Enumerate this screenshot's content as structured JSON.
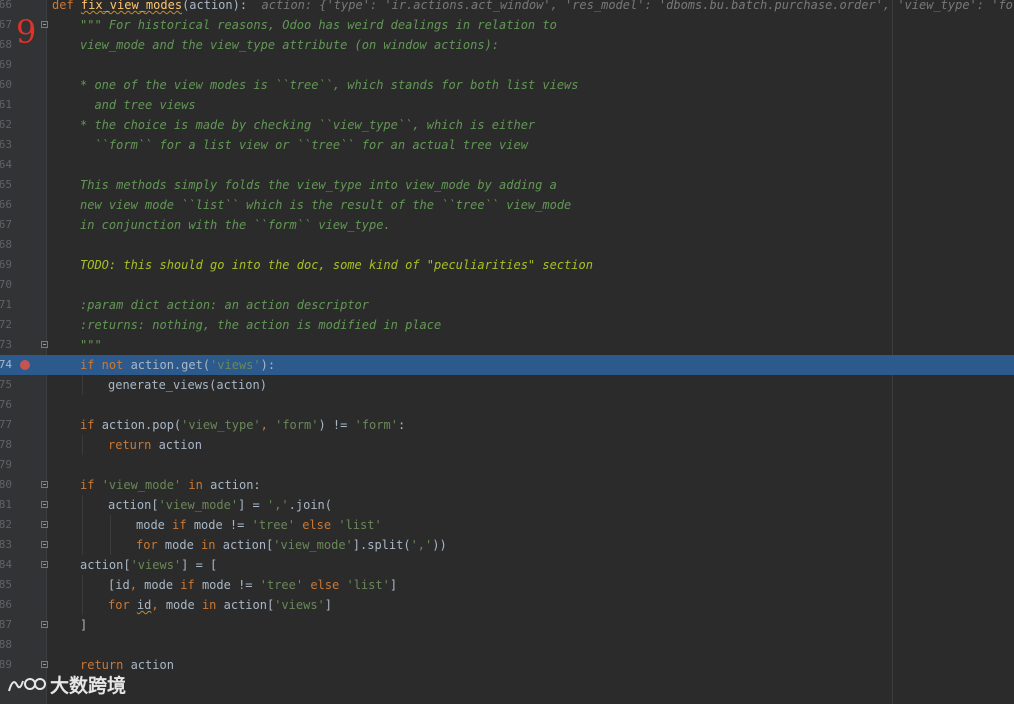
{
  "annotation_badge": "9",
  "watermark_text": "大数跨境",
  "colors": {
    "keyword": "#cc7832",
    "string": "#6a8759",
    "docstring": "#629755",
    "todo": "#a8c023",
    "function": "#ffc66d",
    "selection": "#2d5a8c",
    "breakpoint": "#c75450"
  },
  "lines": [
    {
      "ln": "66",
      "fold": false,
      "bp": false,
      "hl": false,
      "indent": 0,
      "tokens": [
        {
          "t": "kw",
          "v": "def "
        },
        {
          "t": "fn",
          "v": "fix_view_modes",
          "warn": true
        },
        {
          "t": "",
          "v": "(action):  "
        },
        {
          "t": "hint",
          "v": "action: {'type': 'ir.actions.act_window', 'res_model': 'dboms.bu.batch.purchase.order', 'view_type': 'form',"
        }
      ]
    },
    {
      "ln": "67",
      "fold": true,
      "bp": false,
      "hl": false,
      "indent": 1,
      "tokens": [
        {
          "t": "doc",
          "v": "\"\"\" For historical reasons, Odoo has weird dealings in relation to"
        }
      ]
    },
    {
      "ln": "68",
      "fold": false,
      "bp": false,
      "hl": false,
      "indent": 1,
      "tokens": [
        {
          "t": "doc",
          "v": "view_mode and the view_type attribute (on window actions):"
        }
      ]
    },
    {
      "ln": "69",
      "fold": false,
      "bp": false,
      "hl": false,
      "indent": 1,
      "tokens": []
    },
    {
      "ln": "60",
      "fold": false,
      "bp": false,
      "hl": false,
      "indent": 1,
      "tokens": [
        {
          "t": "doc",
          "v": "* one of the view modes is ``tree``, which stands for both list views"
        }
      ]
    },
    {
      "ln": "61",
      "fold": false,
      "bp": false,
      "hl": false,
      "indent": 1,
      "tokens": [
        {
          "t": "doc",
          "v": "  and tree views"
        }
      ]
    },
    {
      "ln": "62",
      "fold": false,
      "bp": false,
      "hl": false,
      "indent": 1,
      "tokens": [
        {
          "t": "doc",
          "v": "* the choice is made by checking ``view_type``, which is either"
        }
      ]
    },
    {
      "ln": "63",
      "fold": false,
      "bp": false,
      "hl": false,
      "indent": 1,
      "tokens": [
        {
          "t": "doc",
          "v": "  ``form`` for a list view or ``tree`` for an actual tree view"
        }
      ]
    },
    {
      "ln": "64",
      "fold": false,
      "bp": false,
      "hl": false,
      "indent": 1,
      "tokens": []
    },
    {
      "ln": "65",
      "fold": false,
      "bp": false,
      "hl": false,
      "indent": 1,
      "tokens": [
        {
          "t": "doc",
          "v": "This methods simply folds the view_type into view_mode by adding a"
        }
      ]
    },
    {
      "ln": "66",
      "fold": false,
      "bp": false,
      "hl": false,
      "indent": 1,
      "tokens": [
        {
          "t": "doc",
          "v": "new view mode ``list`` which is the result of the ``tree`` view_mode"
        }
      ]
    },
    {
      "ln": "67",
      "fold": false,
      "bp": false,
      "hl": false,
      "indent": 1,
      "tokens": [
        {
          "t": "doc",
          "v": "in conjunction with the ``form`` view_type."
        }
      ]
    },
    {
      "ln": "68",
      "fold": false,
      "bp": false,
      "hl": false,
      "indent": 1,
      "tokens": []
    },
    {
      "ln": "69",
      "fold": false,
      "bp": false,
      "hl": false,
      "indent": 1,
      "tokens": [
        {
          "t": "todo",
          "v": "TODO: this should go into the doc, some kind of \"peculiarities\" section"
        }
      ]
    },
    {
      "ln": "70",
      "fold": false,
      "bp": false,
      "hl": false,
      "indent": 1,
      "tokens": []
    },
    {
      "ln": "71",
      "fold": false,
      "bp": false,
      "hl": false,
      "indent": 1,
      "tokens": [
        {
          "t": "doc",
          "v": ":param dict action: an action descriptor"
        }
      ]
    },
    {
      "ln": "72",
      "fold": false,
      "bp": false,
      "hl": false,
      "indent": 1,
      "tokens": [
        {
          "t": "doc",
          "v": ":returns: nothing, the action is modified in place"
        }
      ]
    },
    {
      "ln": "73",
      "fold": true,
      "bp": false,
      "hl": false,
      "indent": 1,
      "tokens": [
        {
          "t": "doc",
          "v": "\"\"\""
        }
      ]
    },
    {
      "ln": "74",
      "fold": false,
      "bp": true,
      "hl": true,
      "indent": 1,
      "tokens": [
        {
          "t": "kw",
          "v": "if not "
        },
        {
          "t": "",
          "v": "action.get("
        },
        {
          "t": "str",
          "v": "'views'"
        },
        {
          "t": "",
          "v": "):"
        }
      ]
    },
    {
      "ln": "75",
      "fold": false,
      "bp": false,
      "hl": false,
      "indent": 2,
      "tokens": [
        {
          "t": "",
          "v": "generate_views(action)"
        }
      ]
    },
    {
      "ln": "76",
      "fold": false,
      "bp": false,
      "hl": false,
      "indent": 1,
      "tokens": []
    },
    {
      "ln": "77",
      "fold": false,
      "bp": false,
      "hl": false,
      "indent": 1,
      "tokens": [
        {
          "t": "kw",
          "v": "if "
        },
        {
          "t": "",
          "v": "action.pop("
        },
        {
          "t": "str",
          "v": "'view_type'"
        },
        {
          "t": "kw",
          "v": ", "
        },
        {
          "t": "str",
          "v": "'form'"
        },
        {
          "t": "",
          "v": ") != "
        },
        {
          "t": "str",
          "v": "'form'"
        },
        {
          "t": "",
          "v": ":"
        }
      ]
    },
    {
      "ln": "78",
      "fold": false,
      "bp": false,
      "hl": false,
      "indent": 2,
      "tokens": [
        {
          "t": "kw",
          "v": "return "
        },
        {
          "t": "",
          "v": "action"
        }
      ]
    },
    {
      "ln": "79",
      "fold": false,
      "bp": false,
      "hl": false,
      "indent": 1,
      "tokens": []
    },
    {
      "ln": "80",
      "fold": true,
      "bp": false,
      "hl": false,
      "indent": 1,
      "tokens": [
        {
          "t": "kw",
          "v": "if "
        },
        {
          "t": "str",
          "v": "'view_mode'"
        },
        {
          "t": "kw",
          "v": " in "
        },
        {
          "t": "",
          "v": "action:"
        }
      ]
    },
    {
      "ln": "81",
      "fold": true,
      "bp": false,
      "hl": false,
      "indent": 2,
      "tokens": [
        {
          "t": "",
          "v": "action["
        },
        {
          "t": "str",
          "v": "'view_mode'"
        },
        {
          "t": "",
          "v": "] = "
        },
        {
          "t": "str",
          "v": "','"
        },
        {
          "t": "",
          "v": ".join("
        }
      ]
    },
    {
      "ln": "82",
      "fold": true,
      "bp": false,
      "hl": false,
      "indent": 3,
      "tokens": [
        {
          "t": "",
          "v": "mode "
        },
        {
          "t": "kw",
          "v": "if "
        },
        {
          "t": "",
          "v": "mode != "
        },
        {
          "t": "str",
          "v": "'tree'"
        },
        {
          "t": "kw",
          "v": " else "
        },
        {
          "t": "str",
          "v": "'list'"
        }
      ]
    },
    {
      "ln": "83",
      "fold": true,
      "bp": false,
      "hl": false,
      "indent": 3,
      "tokens": [
        {
          "t": "kw",
          "v": "for "
        },
        {
          "t": "",
          "v": "mode "
        },
        {
          "t": "kw",
          "v": "in "
        },
        {
          "t": "",
          "v": "action["
        },
        {
          "t": "str",
          "v": "'view_mode'"
        },
        {
          "t": "",
          "v": "].split("
        },
        {
          "t": "str",
          "v": "','"
        },
        {
          "t": "",
          "v": "))"
        }
      ]
    },
    {
      "ln": "84",
      "fold": true,
      "bp": false,
      "hl": false,
      "indent": 1,
      "tokens": [
        {
          "t": "",
          "v": "action["
        },
        {
          "t": "str",
          "v": "'views'"
        },
        {
          "t": "",
          "v": "] = ["
        }
      ]
    },
    {
      "ln": "85",
      "fold": false,
      "bp": false,
      "hl": false,
      "indent": 2,
      "tokens": [
        {
          "t": "",
          "v": "[id"
        },
        {
          "t": "kw",
          "v": ", "
        },
        {
          "t": "",
          "v": "mode "
        },
        {
          "t": "kw",
          "v": "if "
        },
        {
          "t": "",
          "v": "mode != "
        },
        {
          "t": "str",
          "v": "'tree'"
        },
        {
          "t": "kw",
          "v": " else "
        },
        {
          "t": "str",
          "v": "'list'"
        },
        {
          "t": "",
          "v": "]"
        }
      ]
    },
    {
      "ln": "86",
      "fold": false,
      "bp": false,
      "hl": false,
      "indent": 2,
      "tokens": [
        {
          "t": "kw",
          "v": "for "
        },
        {
          "t": "",
          "v": "id",
          "warn": true
        },
        {
          "t": "kw",
          "v": ", "
        },
        {
          "t": "",
          "v": "mode "
        },
        {
          "t": "kw",
          "v": "in "
        },
        {
          "t": "",
          "v": "action["
        },
        {
          "t": "str",
          "v": "'views'"
        },
        {
          "t": "",
          "v": "]"
        }
      ]
    },
    {
      "ln": "87",
      "fold": true,
      "bp": false,
      "hl": false,
      "indent": 1,
      "tokens": [
        {
          "t": "",
          "v": "]"
        }
      ]
    },
    {
      "ln": "88",
      "fold": false,
      "bp": false,
      "hl": false,
      "indent": 1,
      "tokens": []
    },
    {
      "ln": "89",
      "fold": true,
      "bp": false,
      "hl": false,
      "indent": 1,
      "tokens": [
        {
          "t": "kw",
          "v": "return "
        },
        {
          "t": "",
          "v": "action"
        }
      ]
    }
  ]
}
